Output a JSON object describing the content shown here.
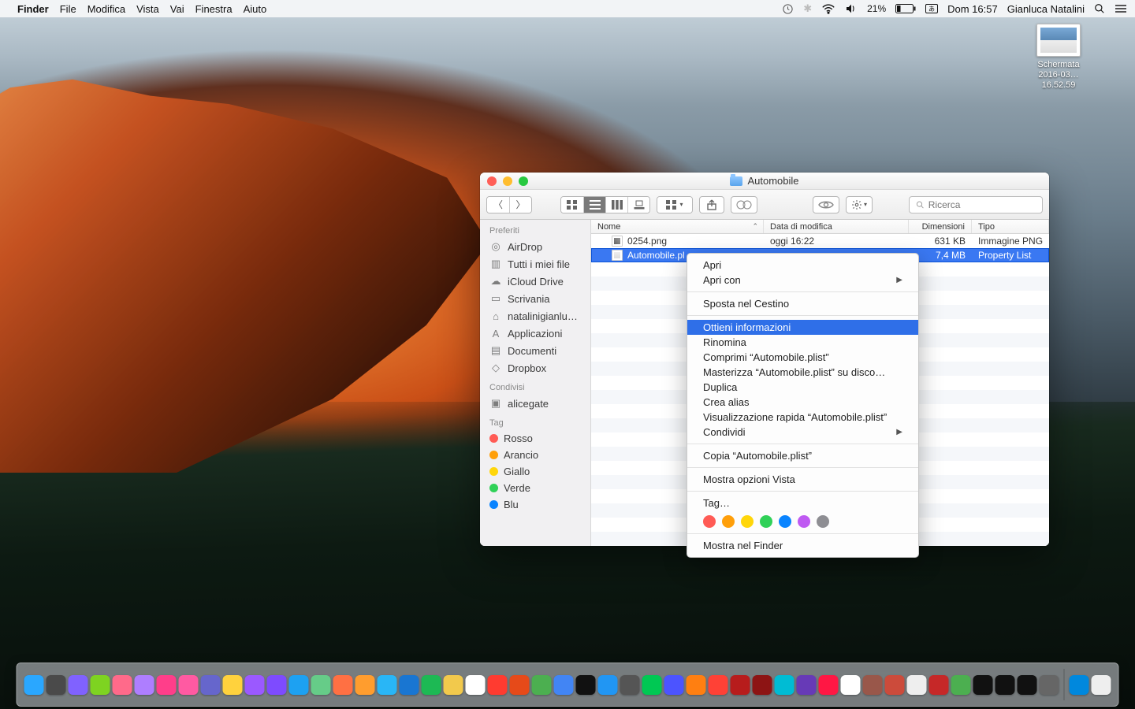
{
  "menubar": {
    "app": "Finder",
    "items": [
      "File",
      "Modifica",
      "Vista",
      "Vai",
      "Finestra",
      "Aiuto"
    ],
    "battery": "21%",
    "clock": "Dom 16:57",
    "user": "Gianluca Natalini"
  },
  "desktop_icon": {
    "label": "Schermata\n2016-03…16.52.59"
  },
  "finder": {
    "title": "Automobile",
    "toolbar": {
      "search_placeholder": "Ricerca"
    },
    "sidebar": {
      "favorites_head": "Preferiti",
      "favorites": [
        "AirDrop",
        "Tutti i miei file",
        "iCloud Drive",
        "Scrivania",
        "natalinigianlu…",
        "Applicazioni",
        "Documenti",
        "Dropbox"
      ],
      "shared_head": "Condivisi",
      "shared": [
        "alicegate"
      ],
      "tags_head": "Tag",
      "tags": [
        {
          "label": "Rosso",
          "color": "#ff5b55"
        },
        {
          "label": "Arancio",
          "color": "#ff9f0a"
        },
        {
          "label": "Giallo",
          "color": "#ffd60a"
        },
        {
          "label": "Verde",
          "color": "#30d158"
        },
        {
          "label": "Blu",
          "color": "#0a84ff"
        }
      ]
    },
    "columns": {
      "name": "Nome",
      "date": "Data di modifica",
      "size": "Dimensioni",
      "kind": "Tipo"
    },
    "rows": [
      {
        "name": "0254.png",
        "date": "oggi 16:22",
        "size": "631 KB",
        "kind": "Immagine PNG",
        "icon": "img",
        "selected": false
      },
      {
        "name": "Automobile.pl",
        "date": "",
        "size": "7,4 MB",
        "kind": "Property List",
        "icon": "plist",
        "selected": true
      }
    ]
  },
  "context_menu": {
    "items": [
      {
        "label": "Apri"
      },
      {
        "label": "Apri con",
        "submenu": true
      },
      {
        "sep": true
      },
      {
        "label": "Sposta nel Cestino"
      },
      {
        "sep": true
      },
      {
        "label": "Ottieni informazioni",
        "selected": true
      },
      {
        "label": "Rinomina"
      },
      {
        "label": "Comprimi “Automobile.plist”"
      },
      {
        "label": "Masterizza “Automobile.plist” su disco…"
      },
      {
        "label": "Duplica"
      },
      {
        "label": "Crea alias"
      },
      {
        "label": "Visualizzazione rapida “Automobile.plist”"
      },
      {
        "label": "Condividi",
        "submenu": true
      },
      {
        "sep": true
      },
      {
        "label": "Copia “Automobile.plist”"
      },
      {
        "sep": true
      },
      {
        "label": "Mostra opzioni Vista"
      },
      {
        "sep": true
      },
      {
        "label": "Tag…"
      },
      {
        "tags": true
      },
      {
        "sep": true
      },
      {
        "label": "Mostra nel Finder"
      }
    ],
    "tag_colors": [
      "#ff5b55",
      "#ff9f0a",
      "#ffd60a",
      "#30d158",
      "#0a84ff",
      "#bf5af2",
      "#8e8e93"
    ]
  },
  "dock_colors": [
    "#2aa7ff",
    "#4a4a4a",
    "#8062ff",
    "#7ed321",
    "#ff6a8a",
    "#ae7eff",
    "#ff3e8a",
    "#ff5aa2",
    "#66c",
    "#ffd23d",
    "#9b59ff",
    "#7e4bff",
    "#1da1f2",
    "#6c8",
    "#ff7043",
    "#ff9d2e",
    "#29b6f6",
    "#1976d2",
    "#1db954",
    "#f2c94c",
    "#ffffff",
    "#ff3b30",
    "#e64a19",
    "#4caf50",
    "#4285f4",
    "#111",
    "#2196f3",
    "#555",
    "#00c853",
    "#4c54ff",
    "#ff7f11",
    "#ff4136",
    "#b71c1c",
    "#8d1414",
    "#00bcd4",
    "#673ab7",
    "#ff1744",
    "#ffffff",
    "#99574a",
    "#cc4b3b",
    "#eee",
    "#c62828",
    "#4caf50",
    "#111",
    "#111",
    "#111",
    "#666",
    "#0088dd",
    "#eeeeee"
  ]
}
